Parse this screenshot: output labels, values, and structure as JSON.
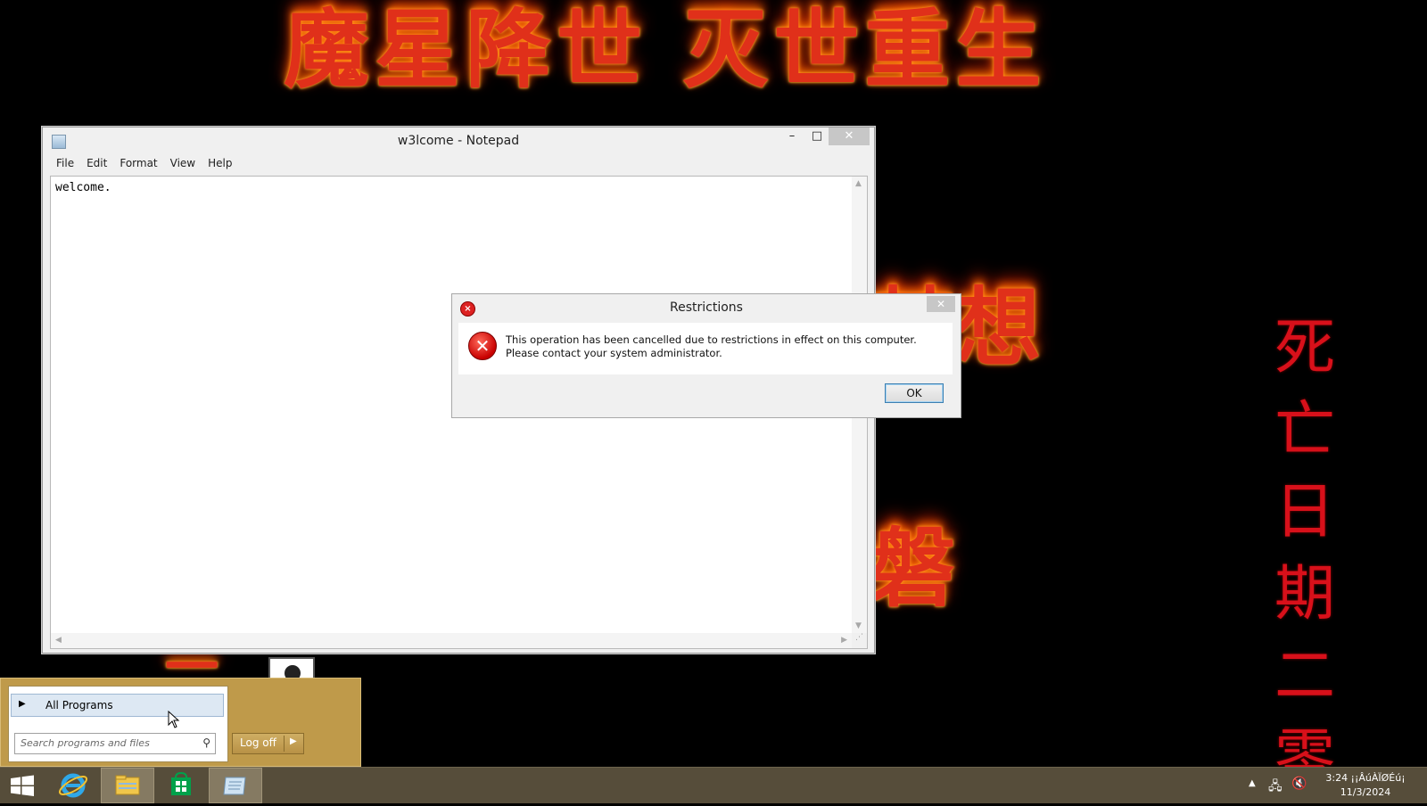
{
  "wallpaper": {
    "top_text": "魔星降世 灭世重生",
    "mid_text_1": "梦想",
    "mid_text_2": "磐",
    "dash_text": "一",
    "vertical_text": [
      "死",
      "亡",
      "日",
      "期",
      "二",
      "零"
    ]
  },
  "notepad": {
    "title": "w3lcome - Notepad",
    "menu": [
      "File",
      "Edit",
      "Format",
      "View",
      "Help"
    ],
    "content": "welcome.",
    "buttons": {
      "minimize": "–",
      "maximize": "□",
      "close": "✕"
    }
  },
  "dialog": {
    "title": "Restrictions",
    "message": "This operation has been cancelled due to restrictions in effect on this computer. Please contact your system administrator.",
    "ok_label": "OK",
    "close_glyph": "✕"
  },
  "start_menu": {
    "all_programs_label": "All Programs",
    "search_placeholder": "Search programs and files",
    "logoff_label": "Log off"
  },
  "taskbar": {
    "items": [
      "windows-start",
      "internet-explorer",
      "file-explorer",
      "windows-store",
      "notepad"
    ],
    "clock_time": "3:24 ¡¡ÂúÀÏØÉú¡",
    "clock_date": "11/3/2024"
  },
  "colors": {
    "taskbar_bg": "#564d3a",
    "start_menu_bg": "#bf9a4a",
    "wallpaper_text": "#e0301a"
  }
}
